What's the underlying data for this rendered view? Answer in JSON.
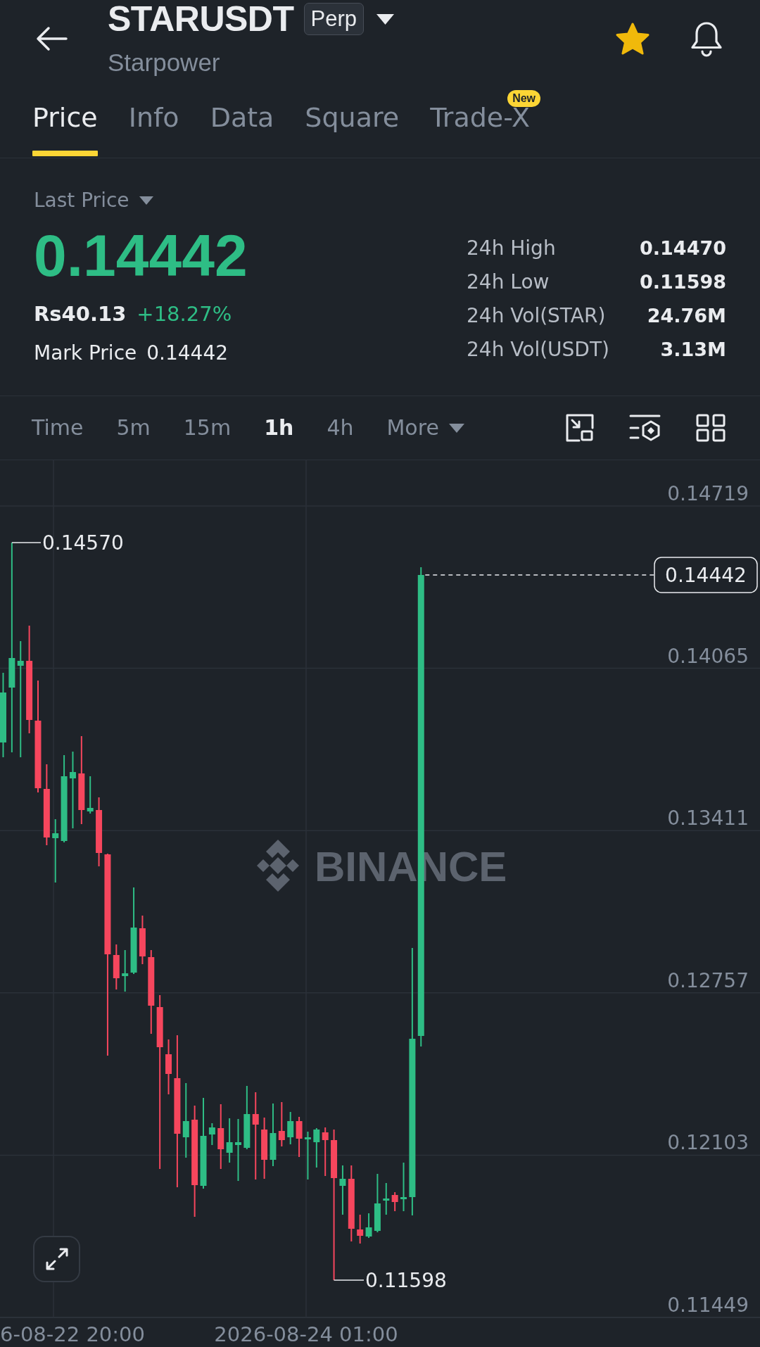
{
  "header": {
    "symbol": "STARUSDT",
    "contract_type": "Perp",
    "name": "Starpower",
    "favorite": true
  },
  "tabs": [
    {
      "label": "Price",
      "selected": true
    },
    {
      "label": "Info",
      "selected": false
    },
    {
      "label": "Data",
      "selected": false
    },
    {
      "label": "Square",
      "selected": false
    },
    {
      "label": "Trade-X",
      "selected": false,
      "badge": "New"
    }
  ],
  "ticker": {
    "price_type": "Last Price",
    "last_price": "0.14442",
    "rising": true,
    "fiat_price": "Rs40.13",
    "change": "+18.27%",
    "mark_price_label": "Mark Price",
    "mark_price": "0.14442",
    "stats": [
      {
        "label": "24h High",
        "value": "0.14470"
      },
      {
        "label": "24h Low",
        "value": "0.11598"
      },
      {
        "label": "24h Vol(STAR)",
        "value": "24.76M"
      },
      {
        "label": "24h Vol(USDT)",
        "value": "3.13M"
      }
    ]
  },
  "timeframes": {
    "intervals": [
      {
        "label": "Time",
        "selected": false
      },
      {
        "label": "5m",
        "selected": false
      },
      {
        "label": "15m",
        "selected": false
      },
      {
        "label": "1h",
        "selected": true
      },
      {
        "label": "4h",
        "selected": false
      }
    ],
    "more": "More"
  },
  "chart": {
    "price_axis": [
      "0.14719",
      "0.14065",
      "0.13411",
      "0.12757",
      "0.12103",
      "0.11449"
    ],
    "time_axis": [
      "6-08-22 20:00",
      "2026-08-24 01:00"
    ],
    "high_marker": "0.14570",
    "low_marker": "0.11598",
    "current_price": "0.14442",
    "watermark": "BINANCE"
  }
}
